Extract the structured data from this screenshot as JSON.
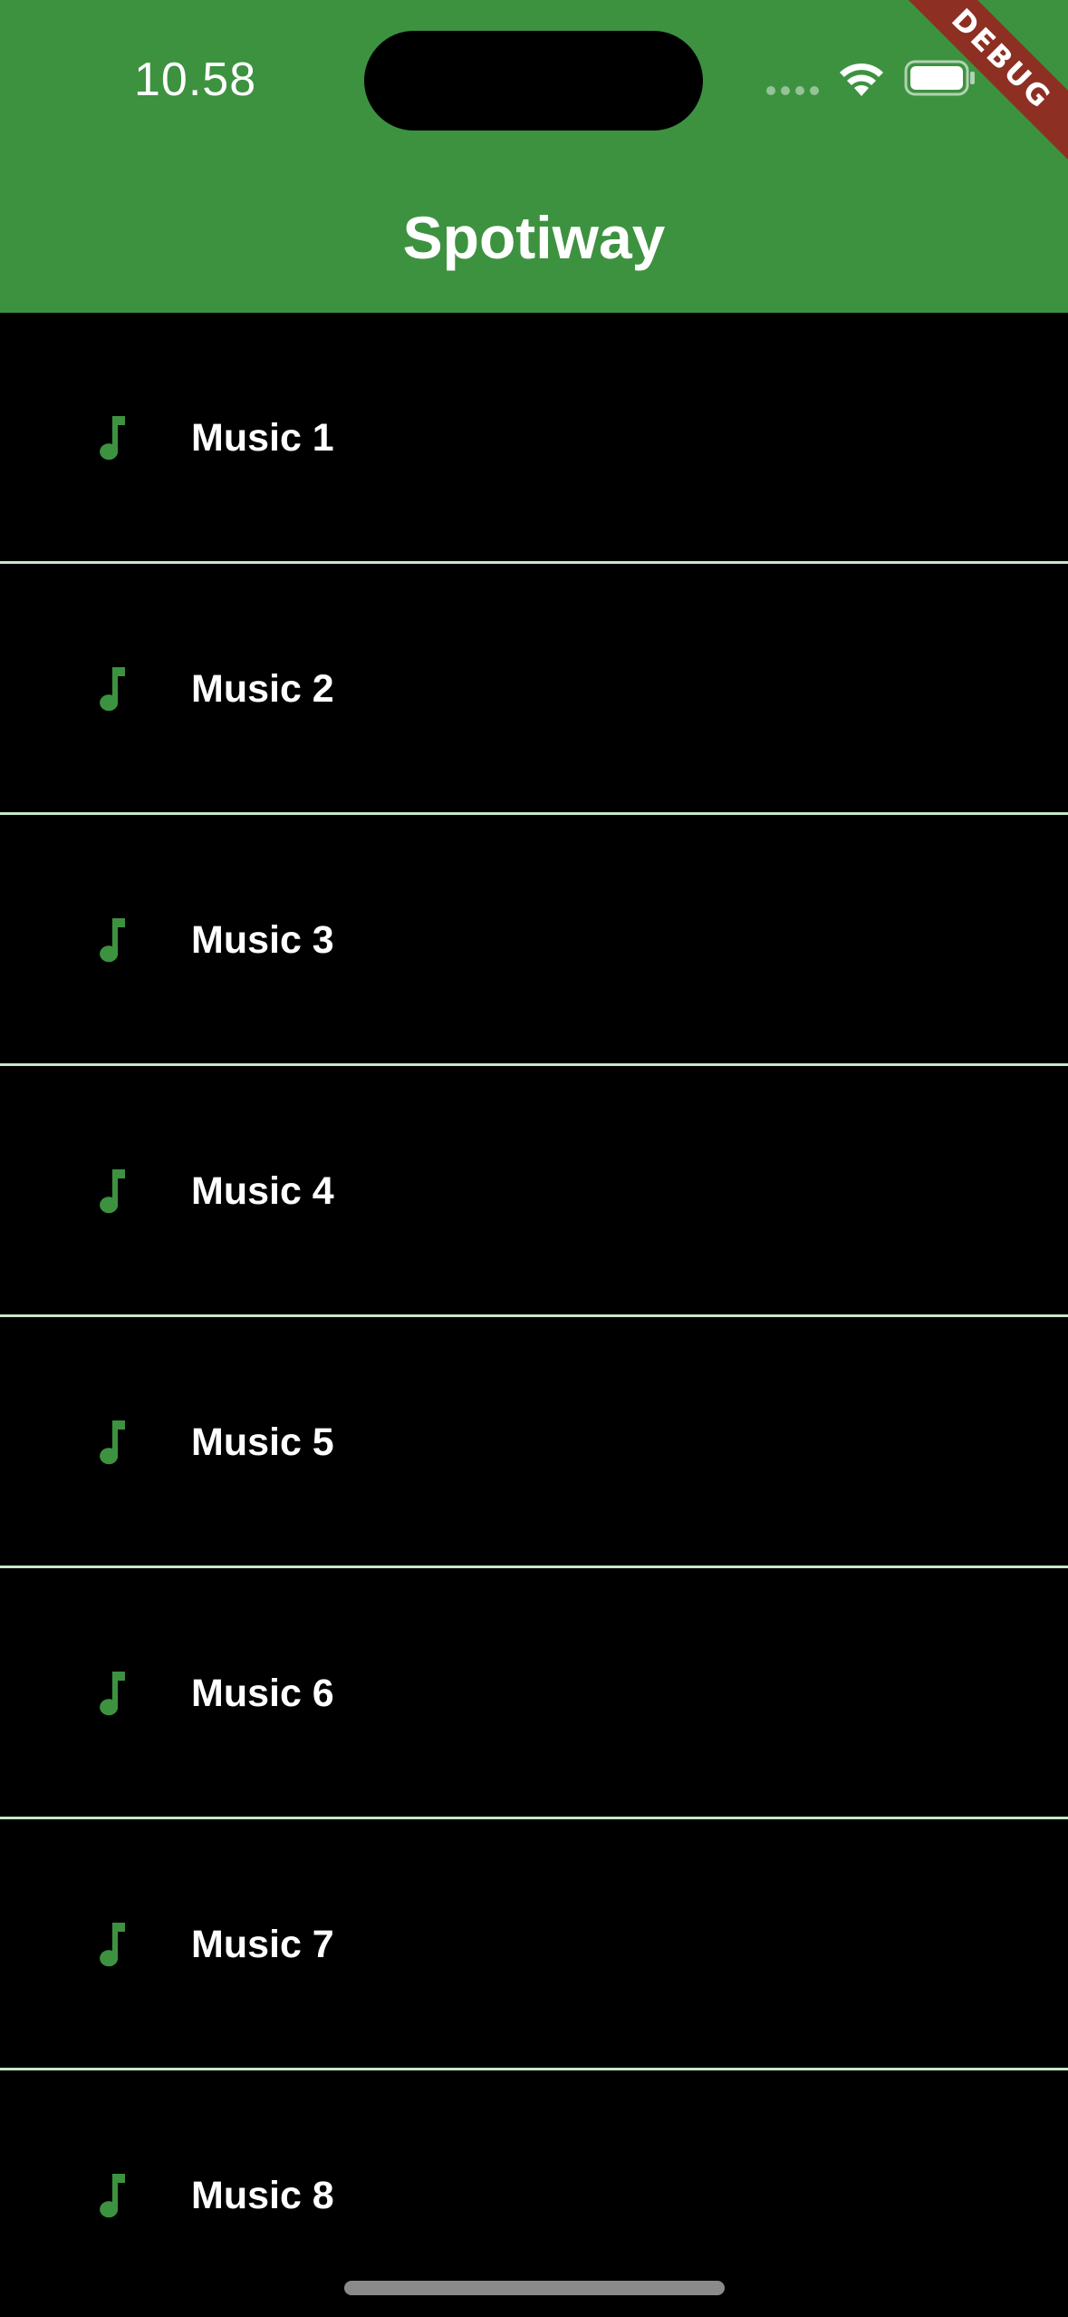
{
  "status_bar": {
    "time": "10.58"
  },
  "debug_banner": {
    "label": "DEBUG",
    "color": "#8d2f22"
  },
  "app_bar": {
    "title": "Spotiway",
    "color": "#3d9240"
  },
  "music_list": {
    "icon": "music-note-icon",
    "icon_color": "#3d9240",
    "divider_color": "#c6e8c8",
    "items": [
      {
        "title": "Music 1"
      },
      {
        "title": "Music 2"
      },
      {
        "title": "Music 3"
      },
      {
        "title": "Music 4"
      },
      {
        "title": "Music 5"
      },
      {
        "title": "Music 6"
      },
      {
        "title": "Music 7"
      },
      {
        "title": "Music 8"
      }
    ]
  }
}
